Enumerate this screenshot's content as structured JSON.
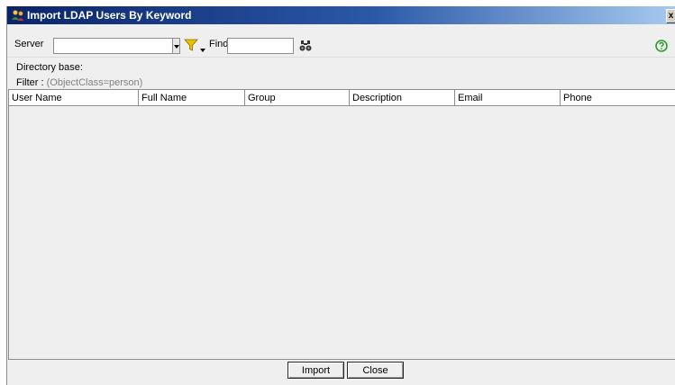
{
  "window": {
    "title": "Import LDAP Users By Keyword",
    "close_label": "x",
    "title_icon": "users-icon"
  },
  "toolbar": {
    "server_label": "Server",
    "server_value": "",
    "find_label": "Find",
    "find_value": "",
    "filter_icon": "funnel-icon",
    "find_icon": "binoculars-icon",
    "help_icon": "help-icon"
  },
  "info": {
    "directory_base_label": "Directory base:",
    "filter_label": "Filter :",
    "filter_value": "(ObjectClass=person)"
  },
  "table": {
    "columns": [
      "User Name",
      "Full Name",
      "Group",
      "Description",
      "Email",
      "Phone"
    ],
    "rows": []
  },
  "buttons": {
    "import_label": "Import",
    "close_label": "Close"
  },
  "colors": {
    "title_start": "#0a246a",
    "title_end": "#a6caf0",
    "window_bg": "#efefef",
    "help_green": "#2e9a2e",
    "filter_yellow": "#e8c100"
  }
}
